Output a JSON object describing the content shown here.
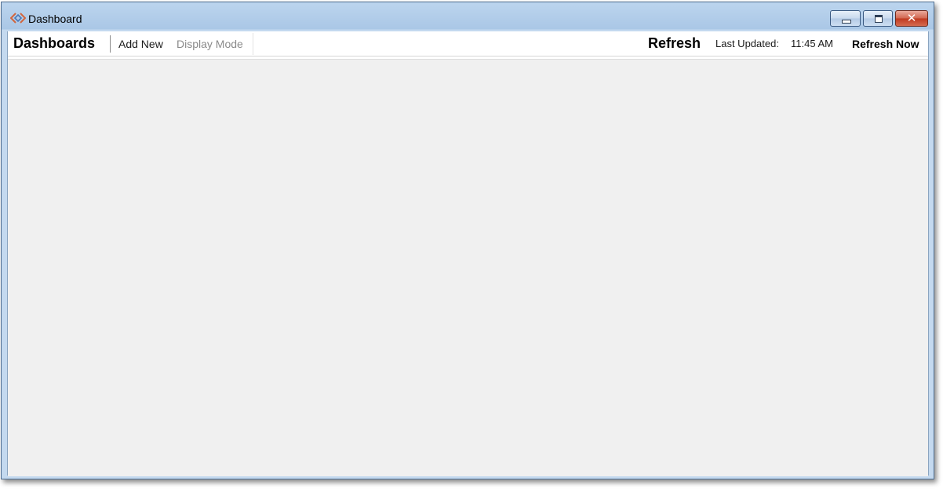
{
  "window": {
    "title": "Dashboard",
    "icon": "app-diamond-icon",
    "controls": {
      "minimize": "minimize-icon",
      "maximize": "restore-icon",
      "close": "close-icon",
      "close_glyph": "✕"
    }
  },
  "toolbar": {
    "title": "Dashboards",
    "add_new": "Add New",
    "display_mode": "Display Mode",
    "refresh_label": "Refresh",
    "last_updated_label": "Last Updated:",
    "last_updated_time": "11:45 AM",
    "refresh_now": "Refresh Now"
  },
  "colors": {
    "accent_close": "#c0391f",
    "disabled_text": "#8a8a8a",
    "content_bg": "#f0f0f0"
  }
}
